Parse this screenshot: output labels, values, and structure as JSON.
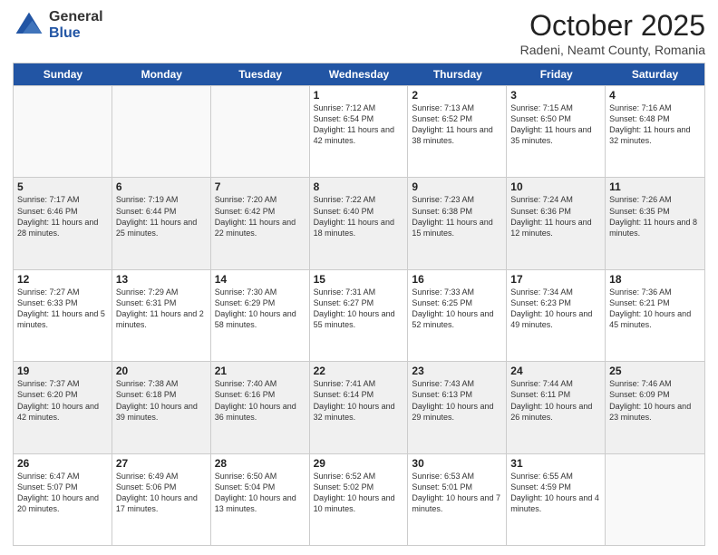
{
  "logo": {
    "line1": "General",
    "line2": "Blue"
  },
  "title": "October 2025",
  "subtitle": "Radeni, Neamt County, Romania",
  "days": [
    "Sunday",
    "Monday",
    "Tuesday",
    "Wednesday",
    "Thursday",
    "Friday",
    "Saturday"
  ],
  "weeks": [
    [
      {
        "day": "",
        "info": ""
      },
      {
        "day": "",
        "info": ""
      },
      {
        "day": "",
        "info": ""
      },
      {
        "day": "1",
        "info": "Sunrise: 7:12 AM\nSunset: 6:54 PM\nDaylight: 11 hours and 42 minutes."
      },
      {
        "day": "2",
        "info": "Sunrise: 7:13 AM\nSunset: 6:52 PM\nDaylight: 11 hours and 38 minutes."
      },
      {
        "day": "3",
        "info": "Sunrise: 7:15 AM\nSunset: 6:50 PM\nDaylight: 11 hours and 35 minutes."
      },
      {
        "day": "4",
        "info": "Sunrise: 7:16 AM\nSunset: 6:48 PM\nDaylight: 11 hours and 32 minutes."
      }
    ],
    [
      {
        "day": "5",
        "info": "Sunrise: 7:17 AM\nSunset: 6:46 PM\nDaylight: 11 hours and 28 minutes."
      },
      {
        "day": "6",
        "info": "Sunrise: 7:19 AM\nSunset: 6:44 PM\nDaylight: 11 hours and 25 minutes."
      },
      {
        "day": "7",
        "info": "Sunrise: 7:20 AM\nSunset: 6:42 PM\nDaylight: 11 hours and 22 minutes."
      },
      {
        "day": "8",
        "info": "Sunrise: 7:22 AM\nSunset: 6:40 PM\nDaylight: 11 hours and 18 minutes."
      },
      {
        "day": "9",
        "info": "Sunrise: 7:23 AM\nSunset: 6:38 PM\nDaylight: 11 hours and 15 minutes."
      },
      {
        "day": "10",
        "info": "Sunrise: 7:24 AM\nSunset: 6:36 PM\nDaylight: 11 hours and 12 minutes."
      },
      {
        "day": "11",
        "info": "Sunrise: 7:26 AM\nSunset: 6:35 PM\nDaylight: 11 hours and 8 minutes."
      }
    ],
    [
      {
        "day": "12",
        "info": "Sunrise: 7:27 AM\nSunset: 6:33 PM\nDaylight: 11 hours and 5 minutes."
      },
      {
        "day": "13",
        "info": "Sunrise: 7:29 AM\nSunset: 6:31 PM\nDaylight: 11 hours and 2 minutes."
      },
      {
        "day": "14",
        "info": "Sunrise: 7:30 AM\nSunset: 6:29 PM\nDaylight: 10 hours and 58 minutes."
      },
      {
        "day": "15",
        "info": "Sunrise: 7:31 AM\nSunset: 6:27 PM\nDaylight: 10 hours and 55 minutes."
      },
      {
        "day": "16",
        "info": "Sunrise: 7:33 AM\nSunset: 6:25 PM\nDaylight: 10 hours and 52 minutes."
      },
      {
        "day": "17",
        "info": "Sunrise: 7:34 AM\nSunset: 6:23 PM\nDaylight: 10 hours and 49 minutes."
      },
      {
        "day": "18",
        "info": "Sunrise: 7:36 AM\nSunset: 6:21 PM\nDaylight: 10 hours and 45 minutes."
      }
    ],
    [
      {
        "day": "19",
        "info": "Sunrise: 7:37 AM\nSunset: 6:20 PM\nDaylight: 10 hours and 42 minutes."
      },
      {
        "day": "20",
        "info": "Sunrise: 7:38 AM\nSunset: 6:18 PM\nDaylight: 10 hours and 39 minutes."
      },
      {
        "day": "21",
        "info": "Sunrise: 7:40 AM\nSunset: 6:16 PM\nDaylight: 10 hours and 36 minutes."
      },
      {
        "day": "22",
        "info": "Sunrise: 7:41 AM\nSunset: 6:14 PM\nDaylight: 10 hours and 32 minutes."
      },
      {
        "day": "23",
        "info": "Sunrise: 7:43 AM\nSunset: 6:13 PM\nDaylight: 10 hours and 29 minutes."
      },
      {
        "day": "24",
        "info": "Sunrise: 7:44 AM\nSunset: 6:11 PM\nDaylight: 10 hours and 26 minutes."
      },
      {
        "day": "25",
        "info": "Sunrise: 7:46 AM\nSunset: 6:09 PM\nDaylight: 10 hours and 23 minutes."
      }
    ],
    [
      {
        "day": "26",
        "info": "Sunrise: 6:47 AM\nSunset: 5:07 PM\nDaylight: 10 hours and 20 minutes."
      },
      {
        "day": "27",
        "info": "Sunrise: 6:49 AM\nSunset: 5:06 PM\nDaylight: 10 hours and 17 minutes."
      },
      {
        "day": "28",
        "info": "Sunrise: 6:50 AM\nSunset: 5:04 PM\nDaylight: 10 hours and 13 minutes."
      },
      {
        "day": "29",
        "info": "Sunrise: 6:52 AM\nSunset: 5:02 PM\nDaylight: 10 hours and 10 minutes."
      },
      {
        "day": "30",
        "info": "Sunrise: 6:53 AM\nSunset: 5:01 PM\nDaylight: 10 hours and 7 minutes."
      },
      {
        "day": "31",
        "info": "Sunrise: 6:55 AM\nSunset: 4:59 PM\nDaylight: 10 hours and 4 minutes."
      },
      {
        "day": "",
        "info": ""
      }
    ]
  ]
}
